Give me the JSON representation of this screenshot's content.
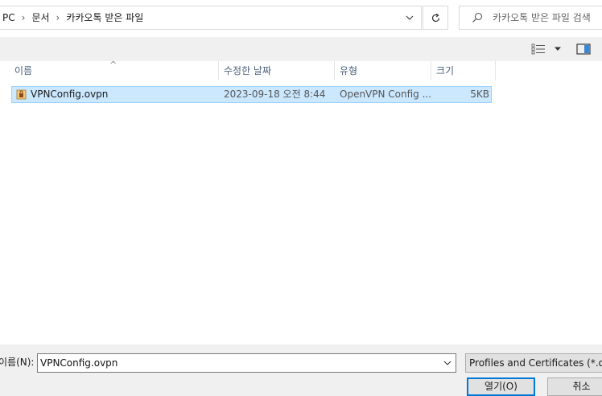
{
  "address_bar": {
    "crumbs": [
      "PC",
      "문서",
      "카카오톡 받은 파일"
    ],
    "separator": "›"
  },
  "search": {
    "placeholder": "카카오톡 받은 파일 검색"
  },
  "columns": {
    "name": "이름",
    "date": "수정한 날짜",
    "type": "유형",
    "size": "크기"
  },
  "files": [
    {
      "name": "VPNConfig.ovpn",
      "date": "2023-09-18 오전 8:44",
      "type": "OpenVPN Config ...",
      "size": "5KB",
      "selected": true
    }
  ],
  "footer": {
    "filename_label": "이름(N):",
    "filename_value": "VPNConfig.ovpn",
    "filter_label": "Profiles and Certificates (*.ovpn",
    "open_label": "열기(O)",
    "cancel_label": "취소"
  },
  "colors": {
    "selection_bg": "#cce8ff",
    "selection_border": "#99d1ff",
    "header_text": "#4c607a",
    "accent": "#0078d7"
  }
}
